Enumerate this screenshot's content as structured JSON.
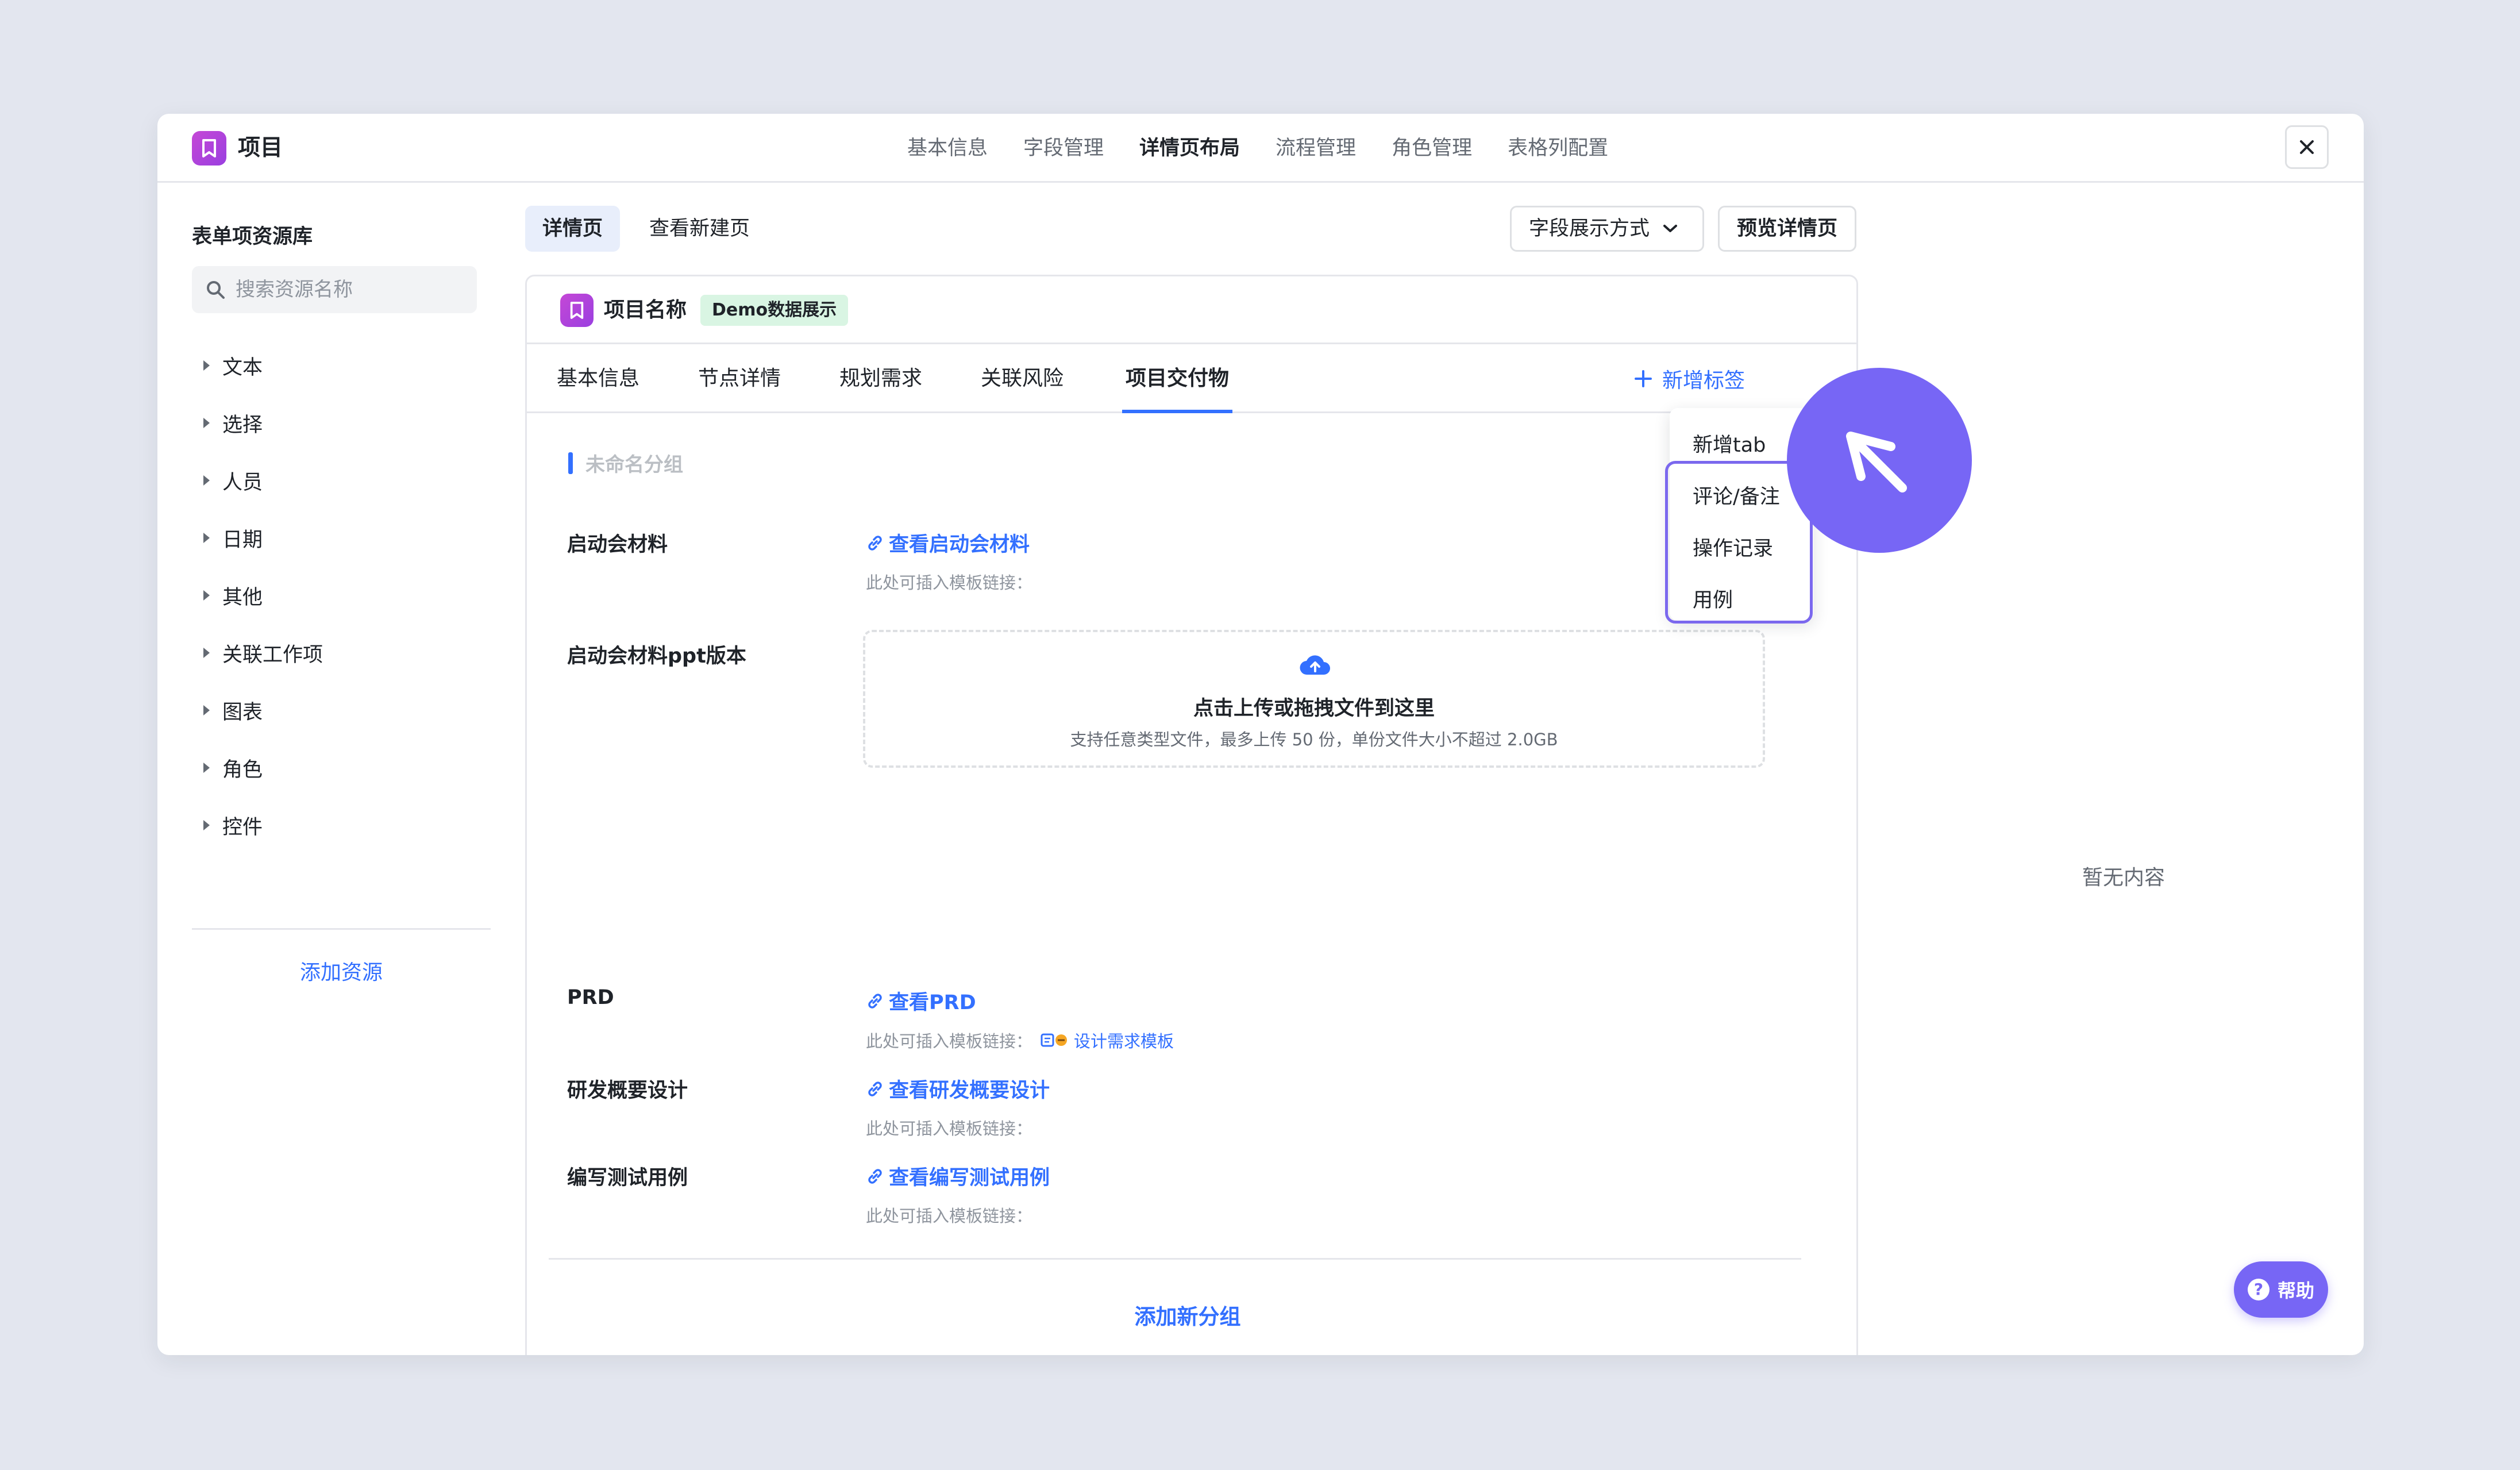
{
  "window": {
    "app_title": "项目",
    "nav_tabs": [
      "基本信息",
      "字段管理",
      "详情页布局",
      "流程管理",
      "角色管理",
      "表格列配置"
    ],
    "active_nav": "详情页布局",
    "close_icon": "close-icon"
  },
  "sidebar": {
    "title": "表单项资源库",
    "search_placeholder": "搜索资源名称",
    "categories": [
      "文本",
      "选择",
      "人员",
      "日期",
      "其他",
      "关联工作项",
      "图表",
      "角色",
      "控件"
    ],
    "add_resource": "添加资源"
  },
  "toolbar": {
    "mode_tabs": [
      "详情页",
      "查看新建页"
    ],
    "field_display": "字段展示方式",
    "preview": "预览详情页"
  },
  "card": {
    "title": "项目名称",
    "badge": "Demo数据展示",
    "tabs": [
      "基本信息",
      "节点详情",
      "规划需求",
      "关联风险",
      "项目交付物"
    ],
    "active_tab": "项目交付物",
    "add_tag": "新增标签",
    "group_title": "未命名分组",
    "fields": [
      {
        "label": "启动会材料",
        "link": "查看启动会材料",
        "hint": "此处可插入模板链接："
      },
      {
        "label": "启动会材料ppt版本"
      },
      {
        "label": "PRD",
        "link": "查看PRD",
        "hint": "此处可插入模板链接：",
        "template": "设计需求模板"
      },
      {
        "label": "研发概要设计",
        "link": "查看研发概要设计",
        "hint": "此处可插入模板链接："
      },
      {
        "label": "编写测试用例",
        "link": "查看编写测试用例",
        "hint": "此处可插入模板链接："
      }
    ],
    "upload": {
      "title": "点击上传或拖拽文件到这里",
      "hint": "支持任意类型文件，最多上传 50 份，单份文件大小不超过 2.0GB"
    },
    "add_group": "添加新分组"
  },
  "dropdown": {
    "items": [
      "新增tab",
      "评论/备注",
      "操作记录",
      "用例"
    ]
  },
  "empty_text": "暂无内容",
  "help": "帮助",
  "colors": {
    "accent": "#3370ff",
    "brand_purple": "#7766f5",
    "badge_green": "#d9f5e3"
  }
}
